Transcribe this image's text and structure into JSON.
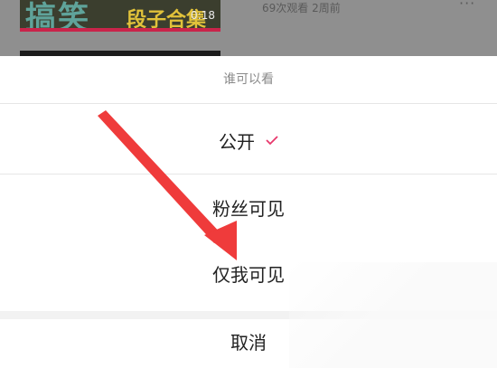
{
  "background": {
    "thumbnail_text_primary": "搞笑",
    "thumbnail_text_secondary": "段子合集",
    "thumbnail_duration": "0:18",
    "meta_text": "69次观看  2周前",
    "more_icon": "more-dots-icon"
  },
  "sheet": {
    "title": "谁可以看",
    "options": [
      {
        "label": "公开",
        "selected": true
      },
      {
        "label": "粉丝可见",
        "selected": false
      },
      {
        "label": "仅我可见",
        "selected": false
      }
    ],
    "cancel_label": "取消"
  },
  "colors": {
    "check": "#e8386c",
    "arrow": "#ef3b3b"
  }
}
